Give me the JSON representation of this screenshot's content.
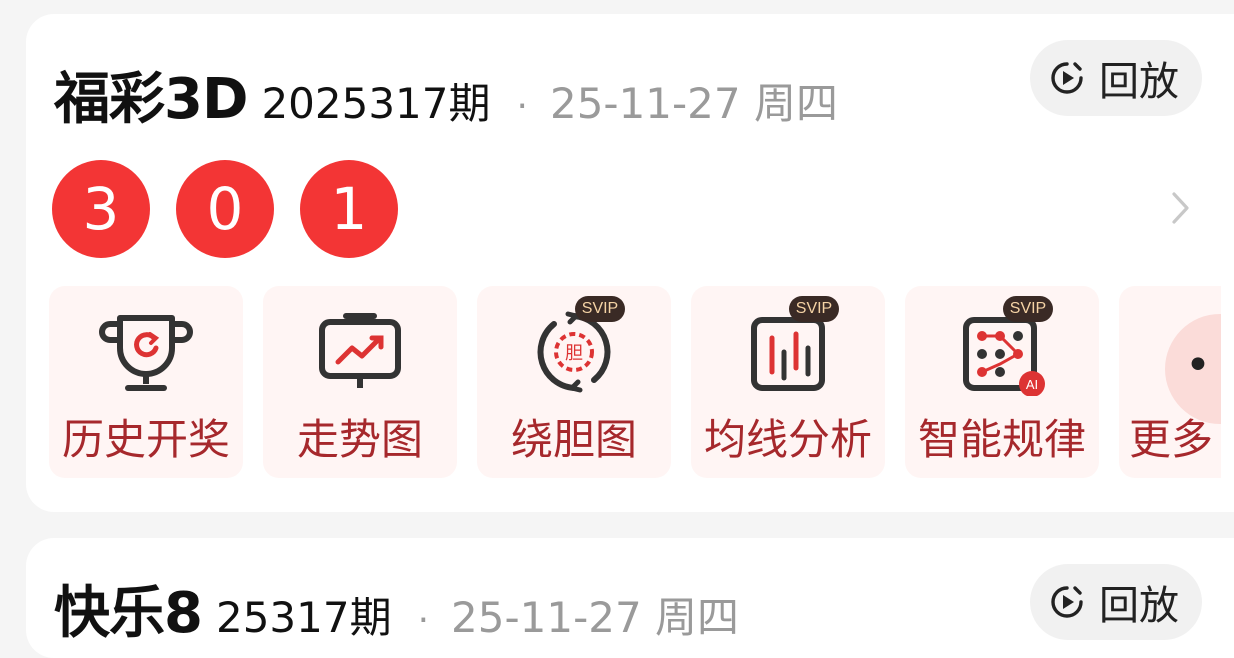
{
  "cards": [
    {
      "game_name": "福彩3D",
      "issue": "2025317期",
      "separator": "·",
      "date": "25-11-27 周四",
      "replay_label": "回放",
      "balls": [
        "3",
        "0",
        "1"
      ],
      "tools": [
        {
          "label": "历史开奖",
          "icon": "trophy-refresh-icon",
          "badge": ""
        },
        {
          "label": "走势图",
          "icon": "trend-monitor-icon",
          "badge": ""
        },
        {
          "label": "绕胆图",
          "icon": "cycle-dan-icon",
          "badge": "SVIP"
        },
        {
          "label": "均线分析",
          "icon": "candlestick-icon",
          "badge": "SVIP"
        },
        {
          "label": "智能规律",
          "icon": "ai-pattern-icon",
          "badge": "SVIP"
        },
        {
          "label": "更多",
          "icon": "more-dots-icon",
          "badge": ""
        }
      ]
    },
    {
      "game_name": "快乐8",
      "issue": "25317期",
      "separator": "·",
      "date": "25-11-27 周四",
      "replay_label": "回放"
    }
  ],
  "colors": {
    "ball_red": "#f33535",
    "tool_label": "#a6282c",
    "tile_bg": "#fff5f4",
    "svip_bg": "#3a2a25"
  }
}
